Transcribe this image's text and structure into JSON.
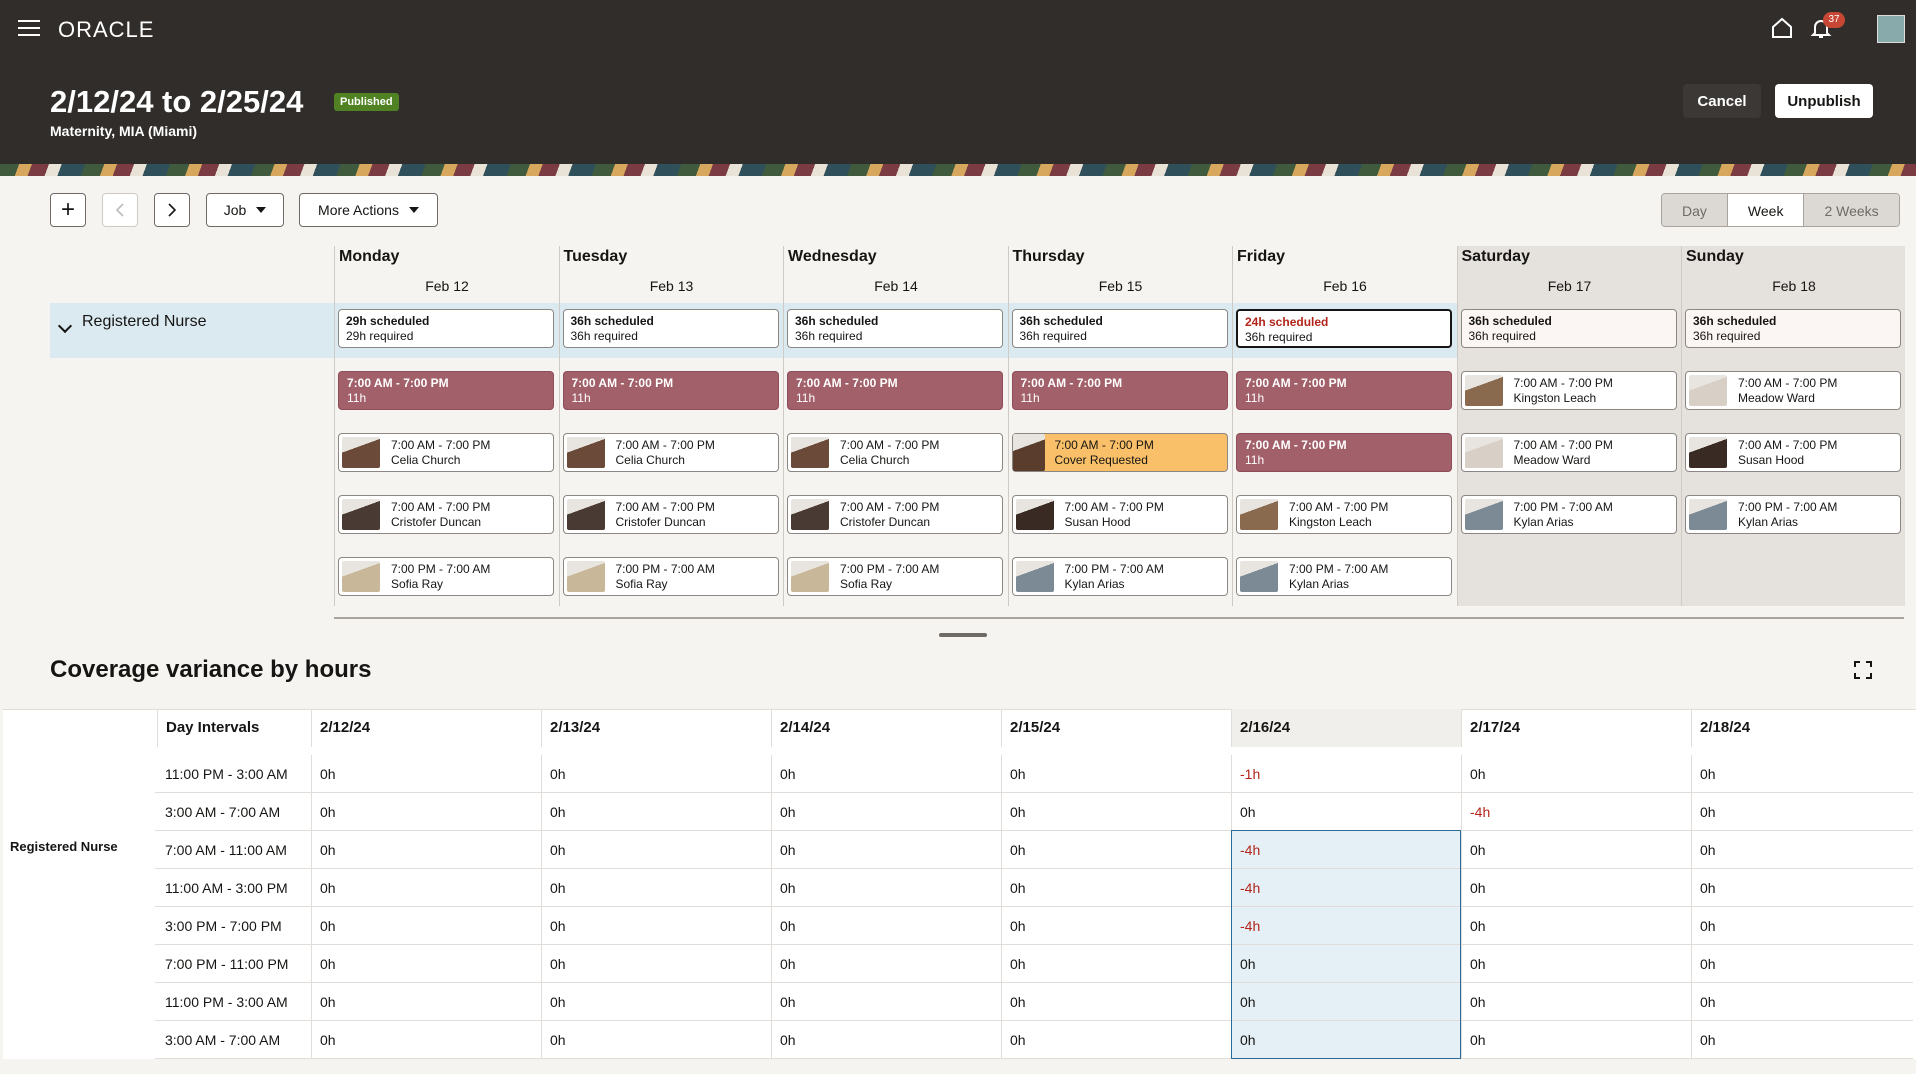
{
  "header": {
    "brand": "ORACLE",
    "notification_count": "37",
    "title": "2/12/24 to 2/25/24",
    "status_badge": "Published",
    "subtitle": "Maternity, MIA (Miami)",
    "cancel_label": "Cancel",
    "unpublish_label": "Unpublish"
  },
  "toolbar": {
    "add_label": "+",
    "job_label": "Job",
    "more_actions_label": "More Actions",
    "views": [
      "Day",
      "Week",
      "2 Weeks"
    ],
    "active_view": "Week"
  },
  "role": {
    "label": "Registered Nurse"
  },
  "days": [
    {
      "name": "Monday",
      "date": "Feb 12",
      "scheduled": "29h scheduled",
      "required": "29h required",
      "weekend": false,
      "short": false,
      "selected": false,
      "shifts": [
        {
          "type": "open",
          "time": "7:00 AM - 7:00 PM",
          "sub": "11h"
        },
        {
          "type": "assigned",
          "time": "7:00 AM - 7:00 PM",
          "sub": "Celia Church",
          "color": "#6b4a3a"
        },
        {
          "type": "assigned",
          "time": "7:00 AM - 7:00 PM",
          "sub": "Cristofer Duncan",
          "color": "#4a3a34"
        },
        {
          "type": "assigned",
          "time": "7:00 PM - 7:00 AM",
          "sub": "Sofia Ray",
          "color": "#c9b79a"
        }
      ]
    },
    {
      "name": "Tuesday",
      "date": "Feb 13",
      "scheduled": "36h scheduled",
      "required": "36h required",
      "weekend": false,
      "short": false,
      "selected": false,
      "shifts": [
        {
          "type": "open",
          "time": "7:00 AM - 7:00 PM",
          "sub": "11h"
        },
        {
          "type": "assigned",
          "time": "7:00 AM - 7:00 PM",
          "sub": "Celia Church",
          "color": "#6b4a3a"
        },
        {
          "type": "assigned",
          "time": "7:00 AM - 7:00 PM",
          "sub": "Cristofer Duncan",
          "color": "#4a3a34"
        },
        {
          "type": "assigned",
          "time": "7:00 PM - 7:00 AM",
          "sub": "Sofia Ray",
          "color": "#c9b79a"
        }
      ]
    },
    {
      "name": "Wednesday",
      "date": "Feb 14",
      "scheduled": "36h scheduled",
      "required": "36h required",
      "weekend": false,
      "short": false,
      "selected": false,
      "shifts": [
        {
          "type": "open",
          "time": "7:00 AM - 7:00 PM",
          "sub": "11h"
        },
        {
          "type": "assigned",
          "time": "7:00 AM - 7:00 PM",
          "sub": "Celia Church",
          "color": "#6b4a3a"
        },
        {
          "type": "assigned",
          "time": "7:00 AM - 7:00 PM",
          "sub": "Cristofer Duncan",
          "color": "#4a3a34"
        },
        {
          "type": "assigned",
          "time": "7:00 PM - 7:00 AM",
          "sub": "Sofia Ray",
          "color": "#c9b79a"
        }
      ]
    },
    {
      "name": "Thursday",
      "date": "Feb 15",
      "scheduled": "36h scheduled",
      "required": "36h required",
      "weekend": false,
      "short": false,
      "selected": false,
      "shifts": [
        {
          "type": "open",
          "time": "7:00 AM - 7:00 PM",
          "sub": "11h"
        },
        {
          "type": "cover",
          "time": "7:00 AM - 7:00 PM",
          "sub": "Cover Requested",
          "color": "#5a3d2c"
        },
        {
          "type": "assigned",
          "time": "7:00 AM - 7:00 PM",
          "sub": "Susan Hood",
          "color": "#3a2a24"
        },
        {
          "type": "assigned",
          "time": "7:00 PM - 7:00 AM",
          "sub": "Kylan Arias",
          "color": "#7c8a96"
        }
      ]
    },
    {
      "name": "Friday",
      "date": "Feb 16",
      "scheduled": "24h scheduled",
      "required": "36h required",
      "weekend": false,
      "short": true,
      "selected": true,
      "shifts": [
        {
          "type": "open",
          "time": "7:00 AM - 7:00 PM",
          "sub": "11h"
        },
        {
          "type": "open",
          "time": "7:00 AM - 7:00 PM",
          "sub": "11h"
        },
        {
          "type": "assigned",
          "time": "7:00 AM - 7:00 PM",
          "sub": "Kingston Leach",
          "color": "#8a6a4e"
        },
        {
          "type": "assigned",
          "time": "7:00 PM - 7:00 AM",
          "sub": "Kylan Arias",
          "color": "#7c8a96"
        }
      ]
    },
    {
      "name": "Saturday",
      "date": "Feb 17",
      "scheduled": "36h scheduled",
      "required": "36h required",
      "weekend": true,
      "short": false,
      "selected": false,
      "shifts": [
        {
          "type": "assigned",
          "time": "7:00 AM - 7:00 PM",
          "sub": "Kingston Leach",
          "color": "#8a6a4e"
        },
        {
          "type": "assigned",
          "time": "7:00 AM - 7:00 PM",
          "sub": "Meadow Ward",
          "color": "#d8d0c6"
        },
        {
          "type": "assigned",
          "time": "7:00 PM - 7:00 AM",
          "sub": "Kylan Arias",
          "color": "#7c8a96"
        }
      ]
    },
    {
      "name": "Sunday",
      "date": "Feb 18",
      "scheduled": "36h scheduled",
      "required": "36h required",
      "weekend": true,
      "short": false,
      "selected": false,
      "shifts": [
        {
          "type": "assigned",
          "time": "7:00 AM - 7:00 PM",
          "sub": "Meadow Ward",
          "color": "#d8d0c6"
        },
        {
          "type": "assigned",
          "time": "7:00 AM - 7:00 PM",
          "sub": "Susan Hood",
          "color": "#3a2a24"
        },
        {
          "type": "assigned",
          "time": "7:00 PM - 7:00 AM",
          "sub": "Kylan Arias",
          "color": "#7c8a96"
        }
      ]
    }
  ],
  "coverage": {
    "title": "Coverage variance by hours",
    "interval_header": "Day Intervals",
    "row_group_label": "Registered Nurse",
    "dates": [
      "2/12/24",
      "2/13/24",
      "2/14/24",
      "2/15/24",
      "2/16/24",
      "2/17/24",
      "2/18/24"
    ],
    "highlight_column": 4,
    "rows": [
      {
        "interval": "11:00 PM - 3:00 AM",
        "values": [
          "0h",
          "0h",
          "0h",
          "0h",
          "-1h",
          "0h",
          "0h"
        ]
      },
      {
        "interval": "3:00 AM - 7:00 AM",
        "values": [
          "0h",
          "0h",
          "0h",
          "0h",
          "0h",
          "-4h",
          "0h"
        ]
      },
      {
        "interval": "7:00 AM - 11:00 AM",
        "values": [
          "0h",
          "0h",
          "0h",
          "0h",
          "-4h",
          "0h",
          "0h"
        ]
      },
      {
        "interval": "11:00 AM - 3:00 PM",
        "values": [
          "0h",
          "0h",
          "0h",
          "0h",
          "-4h",
          "0h",
          "0h"
        ]
      },
      {
        "interval": "3:00 PM - 7:00 PM",
        "values": [
          "0h",
          "0h",
          "0h",
          "0h",
          "-4h",
          "0h",
          "0h"
        ]
      },
      {
        "interval": "7:00 PM - 11:00 PM",
        "values": [
          "0h",
          "0h",
          "0h",
          "0h",
          "0h",
          "0h",
          "0h"
        ]
      },
      {
        "interval": "11:00 PM - 3:00 AM",
        "values": [
          "0h",
          "0h",
          "0h",
          "0h",
          "0h",
          "0h",
          "0h"
        ]
      },
      {
        "interval": "3:00 AM - 7:00 AM",
        "values": [
          "0h",
          "0h",
          "0h",
          "0h",
          "0h",
          "0h",
          "0h"
        ]
      }
    ]
  },
  "colors": {
    "open_shift": "#a2606a",
    "cover_requested": "#f9c069",
    "negative": "#b3251a",
    "published": "#508223"
  }
}
